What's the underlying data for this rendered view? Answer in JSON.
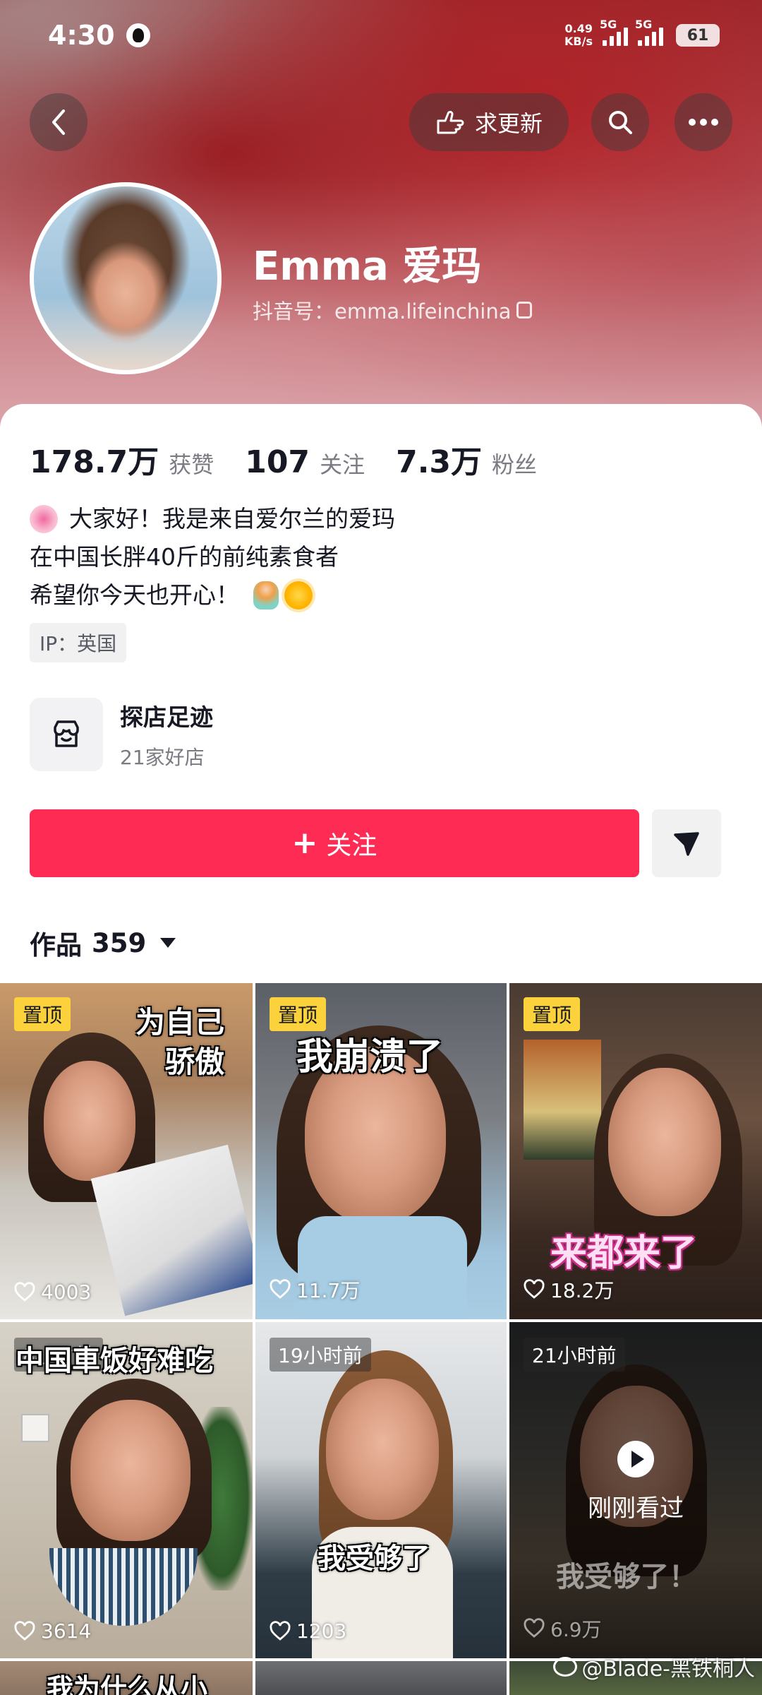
{
  "status_bar": {
    "time": "4:30",
    "net_speed_value": "0.49",
    "net_speed_unit": "KB/s",
    "network_1": "5G",
    "network_2": "5G",
    "battery": "61"
  },
  "header": {
    "request_update_label": "求更新"
  },
  "profile": {
    "name": "Emma 爱玛",
    "douyin_id": "抖音号：emma.lifeinchina"
  },
  "stats": [
    {
      "value": "178.7万",
      "label": "获赞"
    },
    {
      "value": "107",
      "label": "关注"
    },
    {
      "value": "7.3万",
      "label": "粉丝"
    }
  ],
  "bio": {
    "line1": "大家好！我是来自爱尔兰的爱玛",
    "line2": "在中国长胖40斤的前纯素食者",
    "line3": "希望你今天也开心！"
  },
  "ip_tag": "IP：英国",
  "shop": {
    "title": "探店足迹",
    "subtitle": "21家好店"
  },
  "follow_label": "关注",
  "works": {
    "label": "作品",
    "count": "359"
  },
  "videos": [
    {
      "badge": "置顶",
      "caption_line1": "为自己",
      "caption_line2": "骄傲",
      "likes": "4003"
    },
    {
      "badge": "置顶",
      "caption": "我崩溃了",
      "likes": "11.7万"
    },
    {
      "badge": "置顶",
      "caption": "来都来了",
      "likes": "18.2万"
    },
    {
      "time_ago": "8小时前",
      "caption": "中国車饭好难吃",
      "likes": "3614"
    },
    {
      "time_ago": "19小时前",
      "caption": "我受够了",
      "likes": "1203"
    },
    {
      "time_ago": "21小时前",
      "caption": "我受够了！",
      "watched_label": "刚刚看过",
      "likes": "6.9万"
    },
    {
      "caption": "我为什么从小"
    }
  ],
  "watermark": "@Blade-黑铁桐人",
  "colors": {
    "accent": "#fe2c55",
    "pin_badge": "#fbd23b",
    "text_primary": "#161823",
    "text_secondary": "#7a7b83"
  }
}
